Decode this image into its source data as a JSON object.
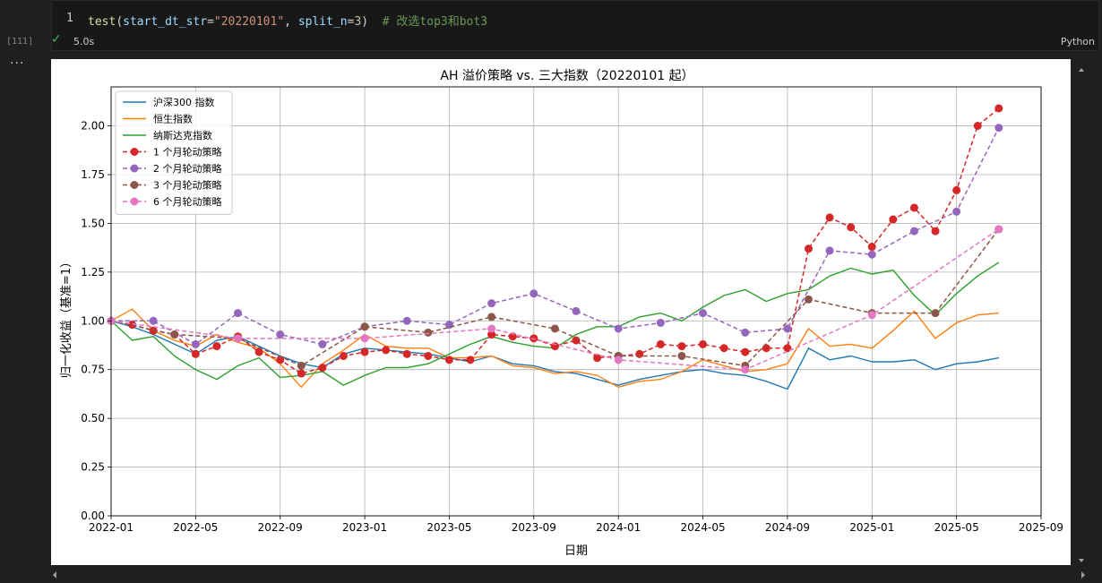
{
  "cell": {
    "line_number": "1",
    "code": {
      "fn": "test",
      "param1": "start_dt_str",
      "value1": "\"20220101\"",
      "param2": "split_n",
      "value2": "3",
      "comment": "# 改选top3和bot3"
    },
    "execution_count": "[111]",
    "elapsed": "5.0s",
    "language": "Python",
    "more": "···"
  },
  "chart_data": {
    "type": "line",
    "title": "AH 溢价策略 vs. 三大指数（20220101 起）",
    "xlabel": "日期",
    "ylabel": "归一化收益（基准=1）",
    "xlim": [
      "2022-01",
      "2025-09"
    ],
    "ylim": [
      0,
      2.2
    ],
    "x_ticks": [
      "2022-01",
      "2022-05",
      "2022-09",
      "2023-01",
      "2023-05",
      "2023-09",
      "2024-01",
      "2024-05",
      "2024-09",
      "2025-01",
      "2025-05",
      "2025-09"
    ],
    "y_ticks": [
      "0.00",
      "0.25",
      "0.50",
      "0.75",
      "1.00",
      "1.25",
      "1.50",
      "1.75",
      "2.00"
    ],
    "grid": true,
    "legend_position": "top-left",
    "series": [
      {
        "name": "沪深300 指数",
        "style": "solid",
        "color": "#1f77b4",
        "points": [
          [
            "2022-01",
            1.0
          ],
          [
            "2022-02",
            0.97
          ],
          [
            "2022-03",
            0.93
          ],
          [
            "2022-04",
            0.88
          ],
          [
            "2022-05",
            0.83
          ],
          [
            "2022-06",
            0.9
          ],
          [
            "2022-07",
            0.92
          ],
          [
            "2022-08",
            0.87
          ],
          [
            "2022-09",
            0.82
          ],
          [
            "2022-10",
            0.78
          ],
          [
            "2022-11",
            0.76
          ],
          [
            "2022-12",
            0.83
          ],
          [
            "2023-01",
            0.86
          ],
          [
            "2023-02",
            0.85
          ],
          [
            "2023-03",
            0.84
          ],
          [
            "2023-04",
            0.83
          ],
          [
            "2023-05",
            0.81
          ],
          [
            "2023-06",
            0.79
          ],
          [
            "2023-07",
            0.82
          ],
          [
            "2023-08",
            0.78
          ],
          [
            "2023-09",
            0.77
          ],
          [
            "2023-10",
            0.74
          ],
          [
            "2023-11",
            0.73
          ],
          [
            "2023-12",
            0.7
          ],
          [
            "2024-01",
            0.67
          ],
          [
            "2024-02",
            0.7
          ],
          [
            "2024-03",
            0.72
          ],
          [
            "2024-04",
            0.74
          ],
          [
            "2024-05",
            0.75
          ],
          [
            "2024-06",
            0.73
          ],
          [
            "2024-07",
            0.72
          ],
          [
            "2024-08",
            0.69
          ],
          [
            "2024-09",
            0.65
          ],
          [
            "2024-10",
            0.86
          ],
          [
            "2024-11",
            0.8
          ],
          [
            "2024-12",
            0.82
          ],
          [
            "2025-01",
            0.79
          ],
          [
            "2025-02",
            0.79
          ],
          [
            "2025-03",
            0.8
          ],
          [
            "2025-04",
            0.75
          ],
          [
            "2025-05",
            0.78
          ],
          [
            "2025-06",
            0.79
          ],
          [
            "2025-07",
            0.81
          ]
        ]
      },
      {
        "name": "恒生指数",
        "style": "solid",
        "color": "#ff7f0e",
        "points": [
          [
            "2022-01",
            1.0
          ],
          [
            "2022-02",
            1.06
          ],
          [
            "2022-03",
            0.95
          ],
          [
            "2022-04",
            0.9
          ],
          [
            "2022-05",
            0.87
          ],
          [
            "2022-06",
            0.93
          ],
          [
            "2022-07",
            0.89
          ],
          [
            "2022-08",
            0.86
          ],
          [
            "2022-09",
            0.78
          ],
          [
            "2022-10",
            0.66
          ],
          [
            "2022-11",
            0.78
          ],
          [
            "2022-12",
            0.85
          ],
          [
            "2023-01",
            0.93
          ],
          [
            "2023-02",
            0.87
          ],
          [
            "2023-03",
            0.86
          ],
          [
            "2023-04",
            0.86
          ],
          [
            "2023-05",
            0.81
          ],
          [
            "2023-06",
            0.81
          ],
          [
            "2023-07",
            0.82
          ],
          [
            "2023-08",
            0.77
          ],
          [
            "2023-09",
            0.76
          ],
          [
            "2023-10",
            0.73
          ],
          [
            "2023-11",
            0.74
          ],
          [
            "2023-12",
            0.72
          ],
          [
            "2024-01",
            0.66
          ],
          [
            "2024-02",
            0.69
          ],
          [
            "2024-03",
            0.7
          ],
          [
            "2024-04",
            0.74
          ],
          [
            "2024-05",
            0.8
          ],
          [
            "2024-06",
            0.77
          ],
          [
            "2024-07",
            0.74
          ],
          [
            "2024-08",
            0.75
          ],
          [
            "2024-09",
            0.78
          ],
          [
            "2024-10",
            0.96
          ],
          [
            "2024-11",
            0.87
          ],
          [
            "2024-12",
            0.88
          ],
          [
            "2025-01",
            0.86
          ],
          [
            "2025-02",
            0.95
          ],
          [
            "2025-03",
            1.05
          ],
          [
            "2025-04",
            0.91
          ],
          [
            "2025-05",
            0.99
          ],
          [
            "2025-06",
            1.03
          ],
          [
            "2025-07",
            1.04
          ]
        ]
      },
      {
        "name": "纳斯达克指数",
        "style": "solid",
        "color": "#2ca02c",
        "points": [
          [
            "2022-01",
            1.0
          ],
          [
            "2022-02",
            0.9
          ],
          [
            "2022-03",
            0.92
          ],
          [
            "2022-04",
            0.82
          ],
          [
            "2022-05",
            0.75
          ],
          [
            "2022-06",
            0.7
          ],
          [
            "2022-07",
            0.77
          ],
          [
            "2022-08",
            0.81
          ],
          [
            "2022-09",
            0.71
          ],
          [
            "2022-10",
            0.72
          ],
          [
            "2022-11",
            0.74
          ],
          [
            "2022-12",
            0.67
          ],
          [
            "2023-01",
            0.72
          ],
          [
            "2023-02",
            0.76
          ],
          [
            "2023-03",
            0.76
          ],
          [
            "2023-04",
            0.78
          ],
          [
            "2023-05",
            0.83
          ],
          [
            "2023-06",
            0.88
          ],
          [
            "2023-07",
            0.92
          ],
          [
            "2023-08",
            0.89
          ],
          [
            "2023-09",
            0.87
          ],
          [
            "2023-10",
            0.86
          ],
          [
            "2023-11",
            0.93
          ],
          [
            "2023-12",
            0.97
          ],
          [
            "2024-01",
            0.97
          ],
          [
            "2024-02",
            1.02
          ],
          [
            "2024-03",
            1.04
          ],
          [
            "2024-04",
            1.0
          ],
          [
            "2024-05",
            1.07
          ],
          [
            "2024-06",
            1.13
          ],
          [
            "2024-07",
            1.16
          ],
          [
            "2024-08",
            1.1
          ],
          [
            "2024-09",
            1.14
          ],
          [
            "2024-10",
            1.16
          ],
          [
            "2024-11",
            1.23
          ],
          [
            "2024-12",
            1.27
          ],
          [
            "2025-01",
            1.24
          ],
          [
            "2025-02",
            1.26
          ],
          [
            "2025-03",
            1.13
          ],
          [
            "2025-04",
            1.03
          ],
          [
            "2025-05",
            1.14
          ],
          [
            "2025-06",
            1.23
          ],
          [
            "2025-07",
            1.3
          ]
        ]
      },
      {
        "name": "1 个月轮动策略",
        "style": "dashed",
        "color": "#d62728",
        "points": [
          [
            "2022-01",
            1.0
          ],
          [
            "2022-02",
            0.98
          ],
          [
            "2022-03",
            0.95
          ],
          [
            "2022-04",
            0.93
          ],
          [
            "2022-05",
            0.83
          ],
          [
            "2022-06",
            0.87
          ],
          [
            "2022-07",
            0.92
          ],
          [
            "2022-08",
            0.84
          ],
          [
            "2022-09",
            0.8
          ],
          [
            "2022-10",
            0.73
          ],
          [
            "2022-11",
            0.76
          ],
          [
            "2022-12",
            0.82
          ],
          [
            "2023-01",
            0.84
          ],
          [
            "2023-02",
            0.85
          ],
          [
            "2023-03",
            0.83
          ],
          [
            "2023-04",
            0.82
          ],
          [
            "2023-05",
            0.8
          ],
          [
            "2023-06",
            0.8
          ],
          [
            "2023-07",
            0.93
          ],
          [
            "2023-08",
            0.92
          ],
          [
            "2023-09",
            0.91
          ],
          [
            "2023-10",
            0.87
          ],
          [
            "2023-11",
            0.9
          ],
          [
            "2023-12",
            0.81
          ],
          [
            "2024-01",
            0.82
          ],
          [
            "2024-02",
            0.83
          ],
          [
            "2024-03",
            0.88
          ],
          [
            "2024-04",
            0.87
          ],
          [
            "2024-05",
            0.88
          ],
          [
            "2024-06",
            0.86
          ],
          [
            "2024-07",
            0.84
          ],
          [
            "2024-08",
            0.86
          ],
          [
            "2024-09",
            0.86
          ],
          [
            "2024-10",
            1.37
          ],
          [
            "2024-11",
            1.53
          ],
          [
            "2024-12",
            1.48
          ],
          [
            "2025-01",
            1.38
          ],
          [
            "2025-02",
            1.52
          ],
          [
            "2025-03",
            1.58
          ],
          [
            "2025-04",
            1.46
          ],
          [
            "2025-05",
            1.67
          ],
          [
            "2025-06",
            2.0
          ],
          [
            "2025-07",
            2.09
          ]
        ]
      },
      {
        "name": "2 个月轮动策略",
        "style": "dashed",
        "color": "#9467bd",
        "points": [
          [
            "2022-01",
            1.0
          ],
          [
            "2022-03",
            1.0
          ],
          [
            "2022-05",
            0.88
          ],
          [
            "2022-07",
            1.04
          ],
          [
            "2022-09",
            0.93
          ],
          [
            "2022-11",
            0.88
          ],
          [
            "2023-01",
            0.97
          ],
          [
            "2023-03",
            1.0
          ],
          [
            "2023-05",
            0.98
          ],
          [
            "2023-07",
            1.09
          ],
          [
            "2023-09",
            1.14
          ],
          [
            "2023-11",
            1.05
          ],
          [
            "2024-01",
            0.96
          ],
          [
            "2024-03",
            0.99
          ],
          [
            "2024-05",
            1.04
          ],
          [
            "2024-07",
            0.94
          ],
          [
            "2024-09",
            0.96
          ],
          [
            "2024-11",
            1.36
          ],
          [
            "2025-01",
            1.34
          ],
          [
            "2025-03",
            1.46
          ],
          [
            "2025-05",
            1.56
          ],
          [
            "2025-07",
            1.99
          ]
        ]
      },
      {
        "name": "3 个月轮动策略",
        "style": "dashed",
        "color": "#8c564b",
        "points": [
          [
            "2022-01",
            1.0
          ],
          [
            "2022-04",
            0.93
          ],
          [
            "2022-07",
            0.91
          ],
          [
            "2022-10",
            0.77
          ],
          [
            "2023-01",
            0.97
          ],
          [
            "2023-04",
            0.94
          ],
          [
            "2023-07",
            1.02
          ],
          [
            "2023-10",
            0.96
          ],
          [
            "2024-01",
            0.82
          ],
          [
            "2024-04",
            0.82
          ],
          [
            "2024-07",
            0.77
          ],
          [
            "2024-10",
            1.11
          ],
          [
            "2025-01",
            1.04
          ],
          [
            "2025-04",
            1.04
          ],
          [
            "2025-07",
            1.47
          ]
        ]
      },
      {
        "name": "6 个月轮动策略",
        "style": "dashed",
        "color": "#e377c2",
        "points": [
          [
            "2022-01",
            1.0
          ],
          [
            "2022-07",
            0.91
          ],
          [
            "2023-01",
            0.91
          ],
          [
            "2023-07",
            0.96
          ],
          [
            "2024-01",
            0.8
          ],
          [
            "2024-07",
            0.75
          ],
          [
            "2025-01",
            1.03
          ],
          [
            "2025-07",
            1.47
          ]
        ]
      }
    ]
  }
}
